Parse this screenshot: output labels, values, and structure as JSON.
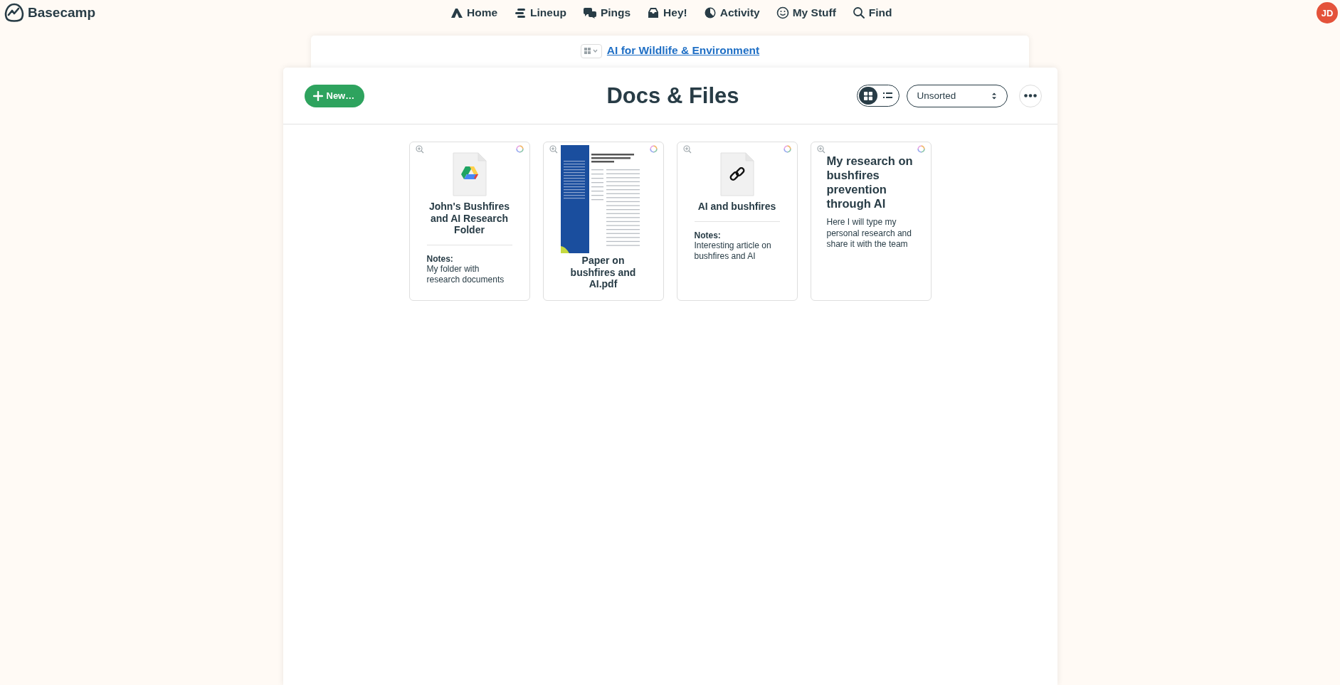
{
  "app": {
    "name": "Basecamp",
    "avatar": "JD"
  },
  "nav": [
    {
      "label": "Home"
    },
    {
      "label": "Lineup"
    },
    {
      "label": "Pings"
    },
    {
      "label": "Hey!"
    },
    {
      "label": "Activity"
    },
    {
      "label": "My Stuff"
    },
    {
      "label": "Find"
    }
  ],
  "project": {
    "name": "AI for Wildlife & Environment"
  },
  "page": {
    "title": "Docs & Files",
    "new_button": "New…",
    "sort": "Unsorted"
  },
  "views": [
    {
      "kind": "grid",
      "selected": true
    },
    {
      "kind": "list",
      "selected": false
    }
  ],
  "cards": [
    {
      "kind": "drive",
      "title": "John's Bushfires and AI Research Folder",
      "notes_label": "Notes:",
      "notes": "My folder with research documents"
    },
    {
      "kind": "pdf",
      "title": "Paper on bushfires and AI.pdf"
    },
    {
      "kind": "link",
      "title": "AI and bushfires",
      "notes_label": "Notes:",
      "notes": "Interesting article on bushfires and AI"
    },
    {
      "kind": "doc",
      "title": "My research on bushfires prevention through AI",
      "excerpt": "Here I will type my personal research and share it with the team"
    }
  ]
}
